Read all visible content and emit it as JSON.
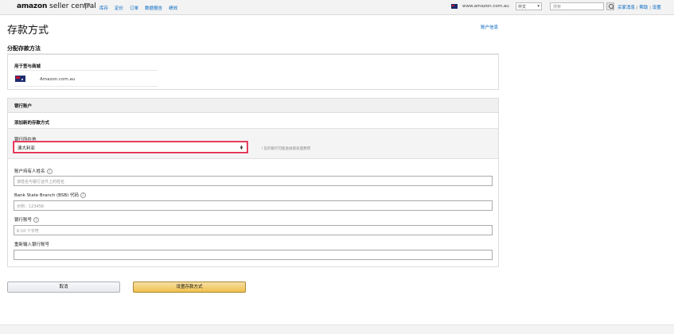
{
  "header": {
    "logo_bold": "amazon",
    "logo_rest": " seller central",
    "nav": [
      "库存",
      "定价",
      "订单",
      "数据报告",
      "绩效"
    ],
    "marketplace": "www.amazon.com.au",
    "language": "中文",
    "search_placeholder": "搜索",
    "links": [
      "买家消息",
      "帮助",
      "设置"
    ]
  },
  "page": {
    "title": "存款方式",
    "account_info": "账户信息",
    "section_title": "分配存款方法"
  },
  "marketplace_box": {
    "label": "用于签与商城",
    "marketplace": "Amazon.com.au"
  },
  "bank_box": {
    "header": "银行账户",
    "subheader": "添加新的存款方式",
    "bank_location_label": "银行所在地",
    "bank_location_value": "澳大利亚",
    "bank_location_hint": "i 您的银行可能会收取处理费用",
    "account_holder_label": "账户持有人姓名",
    "account_holder_placeholder": "该姓名与银行证件上的姓名",
    "bsb_label": "Bank State Branch (BSB) 代码",
    "bsb_placeholder": "示例：123456",
    "account_number_label": "银行账号",
    "account_number_placeholder": "6-10 个字符",
    "reenter_label": "重新输入银行账号",
    "reenter_placeholder": ""
  },
  "buttons": {
    "cancel": "取消",
    "save": "设置存款方式"
  },
  "colors": {
    "link": "#0066c0",
    "save_button": "#f0c14b",
    "select_highlight": "#dd2233"
  }
}
